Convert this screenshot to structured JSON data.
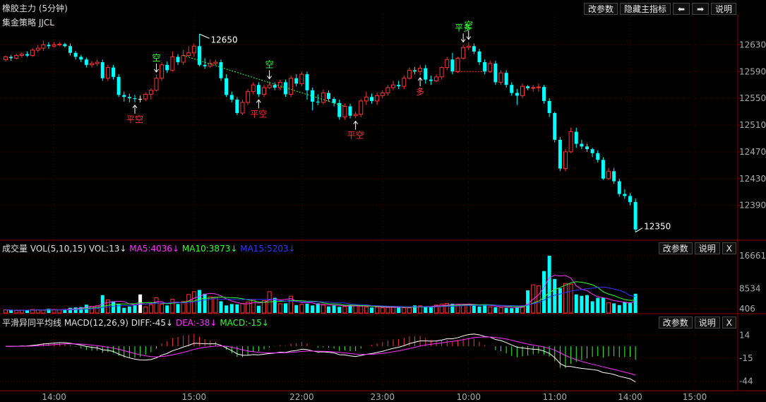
{
  "header": {
    "title": "橡胶主力 (5分钟)",
    "strategy": "集金策略 JJCL",
    "buttons": {
      "params": "改参数",
      "hide_main": "隐藏主指标",
      "prev": "⬅",
      "next": "➡",
      "help": "说明"
    }
  },
  "volume_panel": {
    "label_parts": [
      {
        "text": "成交量 VOL(5,10,15) VOL:13↓",
        "color": "#e0e0e0"
      },
      {
        "text": "MA5:4036↓",
        "color": "#ff33ff"
      },
      {
        "text": "MA10:3873↓",
        "color": "#33ff33"
      },
      {
        "text": "MA15:5203↓",
        "color": "#3333ff"
      }
    ],
    "buttons": {
      "params": "改参数",
      "help": "说明",
      "close": "X"
    }
  },
  "macd_panel": {
    "label_parts": [
      {
        "text": "平滑异同平均线 MACD(12,26,9) DIFF:-45↓",
        "color": "#e0e0e0"
      },
      {
        "text": "DEA:-38↓",
        "color": "#ff33ff"
      },
      {
        "text": "MACD:-15↓",
        "color": "#33ff33"
      }
    ],
    "buttons": {
      "params": "改参数",
      "help": "说明",
      "close": "X"
    }
  },
  "colors": {
    "up": "#ff3333",
    "down": "#00ffff",
    "flat": "#ffffff",
    "grid": "#4a0000",
    "axis": "#aaaaaa"
  },
  "chart_data": [
    {
      "type": "candlestick",
      "yticks": [
        12630,
        12590,
        12550,
        12510,
        12470,
        12430,
        12390
      ],
      "ylim": [
        12340,
        12660
      ],
      "annotations": {
        "high_value": "12650",
        "low_value": "12350"
      },
      "candles": [
        [
          12608,
          12612,
          12614,
          12605
        ],
        [
          12612,
          12610,
          12615,
          12606
        ],
        [
          12610,
          12614,
          12617,
          12608
        ],
        [
          12614,
          12616,
          12619,
          12611
        ],
        [
          12616,
          12614,
          12620,
          12612
        ],
        [
          12614,
          12622,
          12625,
          12612
        ],
        [
          12622,
          12625,
          12630,
          12619
        ],
        [
          12625,
          12630,
          12636,
          12621
        ],
        [
          12630,
          12628,
          12634,
          12624
        ],
        [
          12628,
          12630,
          12634,
          12626
        ],
        [
          12630,
          12631,
          12634,
          12628
        ],
        [
          12631,
          12628,
          12633,
          12626
        ],
        [
          12628,
          12618,
          12632,
          12614
        ],
        [
          12618,
          12612,
          12621,
          12608
        ],
        [
          12612,
          12608,
          12615,
          12604
        ],
        [
          12608,
          12600,
          12611,
          12596
        ],
        [
          12600,
          12602,
          12606,
          12596
        ],
        [
          12602,
          12604,
          12608,
          12598
        ],
        [
          12604,
          12580,
          12608,
          12576
        ],
        [
          12580,
          12596,
          12600,
          12576
        ],
        [
          12596,
          12582,
          12600,
          12578
        ],
        [
          12582,
          12555,
          12586,
          12552
        ],
        [
          12555,
          12552,
          12560,
          12545
        ],
        [
          12552,
          12550,
          12557,
          12544
        ],
        [
          12550,
          12549,
          12555,
          12544
        ],
        [
          12549,
          12549,
          12554,
          12544
        ],
        [
          12549,
          12556,
          12559,
          12546
        ],
        [
          12556,
          12562,
          12565,
          12548
        ],
        [
          12562,
          12580,
          12585,
          12560
        ],
        [
          12580,
          12600,
          12604,
          12576
        ],
        [
          12600,
          12592,
          12605,
          12588
        ],
        [
          12592,
          12612,
          12620,
          12590
        ],
        [
          12612,
          12604,
          12616,
          12600
        ],
        [
          12604,
          12614,
          12622,
          12600
        ],
        [
          12614,
          12618,
          12628,
          12612
        ],
        [
          12618,
          12628,
          12632,
          12612
        ],
        [
          12628,
          12600,
          12646,
          12598
        ],
        [
          12600,
          12598,
          12610,
          12594
        ],
        [
          12598,
          12602,
          12608,
          12595
        ],
        [
          12602,
          12604,
          12608,
          12599
        ],
        [
          12604,
          12580,
          12608,
          12576
        ],
        [
          12580,
          12555,
          12586,
          12552
        ],
        [
          12555,
          12548,
          12560,
          12544
        ],
        [
          12548,
          12528,
          12552,
          12525
        ],
        [
          12528,
          12544,
          12548,
          12525
        ],
        [
          12544,
          12560,
          12564,
          12540
        ],
        [
          12560,
          12570,
          12574,
          12556
        ],
        [
          12570,
          12556,
          12574,
          12552
        ],
        [
          12556,
          12566,
          12570,
          12552
        ],
        [
          12566,
          12570,
          12575,
          12564
        ],
        [
          12570,
          12566,
          12574,
          12562
        ],
        [
          12566,
          12574,
          12578,
          12562
        ],
        [
          12574,
          12556,
          12578,
          12552
        ],
        [
          12556,
          12580,
          12584,
          12552
        ],
        [
          12580,
          12572,
          12586,
          12568
        ],
        [
          12572,
          12586,
          12590,
          12568
        ],
        [
          12586,
          12562,
          12590,
          12548
        ],
        [
          12562,
          12545,
          12566,
          12532
        ],
        [
          12545,
          12544,
          12556,
          12540
        ],
        [
          12544,
          12558,
          12563,
          12541
        ],
        [
          12558,
          12549,
          12562,
          12545
        ],
        [
          12549,
          12543,
          12552,
          12538
        ],
        [
          12543,
          12522,
          12548,
          12518
        ],
        [
          12522,
          12538,
          12542,
          12518
        ],
        [
          12538,
          12524,
          12542,
          12520
        ],
        [
          12524,
          12526,
          12530,
          12520
        ],
        [
          12526,
          12546,
          12549,
          12522
        ],
        [
          12546,
          12552,
          12560,
          12540
        ],
        [
          12552,
          12546,
          12557,
          12542
        ],
        [
          12546,
          12554,
          12559,
          12540
        ],
        [
          12554,
          12558,
          12562,
          12550
        ],
        [
          12558,
          12566,
          12570,
          12554
        ],
        [
          12566,
          12570,
          12576,
          12562
        ],
        [
          12570,
          12568,
          12576,
          12564
        ],
        [
          12568,
          12580,
          12584,
          12564
        ],
        [
          12580,
          12592,
          12596,
          12578
        ],
        [
          12592,
          12590,
          12597,
          12586
        ],
        [
          12590,
          12595,
          12600,
          12585
        ],
        [
          12595,
          12578,
          12600,
          12572
        ],
        [
          12578,
          12576,
          12584,
          12570
        ],
        [
          12576,
          12582,
          12586,
          12574
        ],
        [
          12582,
          12596,
          12598,
          12578
        ],
        [
          12596,
          12608,
          12612,
          12592
        ],
        [
          12608,
          12590,
          12618,
          12586
        ],
        [
          12590,
          12610,
          12612,
          12588
        ],
        [
          12610,
          12626,
          12630,
          12608
        ],
        [
          12626,
          12628,
          12634,
          12622
        ],
        [
          12628,
          12620,
          12632,
          12616
        ],
        [
          12620,
          12604,
          12624,
          12600
        ],
        [
          12604,
          12590,
          12608,
          12586
        ],
        [
          12590,
          12602,
          12606,
          12588
        ],
        [
          12602,
          12574,
          12606,
          12570
        ],
        [
          12574,
          12588,
          12592,
          12570
        ],
        [
          12588,
          12570,
          12592,
          12566
        ],
        [
          12570,
          12558,
          12574,
          12554
        ],
        [
          12558,
          12554,
          12564,
          12540
        ],
        [
          12554,
          12568,
          12572,
          12550
        ],
        [
          12568,
          12565,
          12570,
          12562
        ],
        [
          12565,
          12566,
          12570,
          12560
        ],
        [
          12566,
          12567,
          12572,
          12560
        ],
        [
          12567,
          12546,
          12570,
          12542
        ],
        [
          12546,
          12528,
          12550,
          12522
        ],
        [
          12528,
          12488,
          12530,
          12484
        ],
        [
          12488,
          12445,
          12492,
          12441
        ],
        [
          12445,
          12470,
          12474,
          12441
        ],
        [
          12470,
          12500,
          12506,
          12468
        ],
        [
          12500,
          12482,
          12506,
          12476
        ],
        [
          12482,
          12478,
          12488,
          12474
        ],
        [
          12478,
          12474,
          12482,
          12470
        ],
        [
          12474,
          12468,
          12476,
          12462
        ],
        [
          12468,
          12458,
          12472,
          12454
        ],
        [
          12458,
          12430,
          12462,
          12428
        ],
        [
          12430,
          12441,
          12446,
          12428
        ],
        [
          12441,
          12426,
          12446,
          12422
        ],
        [
          12426,
          12407,
          12430,
          12403
        ],
        [
          12407,
          12404,
          12414,
          12400
        ],
        [
          12404,
          12395,
          12408,
          12390
        ],
        [
          12395,
          12354,
          12400,
          12350
        ]
      ],
      "trendlines": [
        {
          "from": 33,
          "to": 63,
          "color": "#33ff33"
        },
        {
          "from": 83,
          "to": 89,
          "color": "#ff3333"
        }
      ],
      "signals": [
        {
          "index": 24,
          "text": "平空",
          "color": "#ff3333",
          "pos": "below"
        },
        {
          "index": 28,
          "text": "空",
          "color": "#33ff33",
          "pos": "above"
        },
        {
          "index": 47,
          "text": "平空",
          "color": "#ff3333",
          "pos": "below"
        },
        {
          "index": 49,
          "text": "空",
          "color": "#33ff33",
          "pos": "above"
        },
        {
          "index": 65,
          "text": "平空",
          "color": "#ff3333",
          "pos": "below"
        },
        {
          "index": 77,
          "text": "多",
          "color": "#ff3333",
          "pos": "below"
        },
        {
          "index": 85,
          "text": "平多",
          "color": "#33ff33",
          "pos": "above"
        },
        {
          "index": 86,
          "text": "空",
          "color": "#33ff33",
          "pos": "above"
        }
      ]
    },
    {
      "type": "bar",
      "yticks": [
        "16661",
        "8534",
        "406"
      ],
      "ylim": [
        0,
        16661
      ],
      "volume": [
        900,
        800,
        700,
        800,
        900,
        1000,
        900,
        800,
        1200,
        1000,
        900,
        1100,
        1500,
        1600,
        1700,
        2400,
        1900,
        2100,
        5200,
        3800,
        3400,
        2600,
        1500,
        1900,
        2400,
        5400,
        1800,
        2400,
        4400,
        2600,
        2200,
        4000,
        2600,
        3300,
        5400,
        6200,
        6700,
        5600,
        4700,
        4600,
        3400,
        2200,
        2600,
        2500,
        2800,
        3200,
        3900,
        2100,
        3600,
        6200,
        4400,
        2700,
        2800,
        4900,
        2300,
        2500,
        2700,
        2200,
        2800,
        2300,
        1900,
        2200,
        1800,
        1900,
        2400,
        2100,
        2000,
        1800,
        1600,
        1700,
        1500,
        1600,
        1700,
        1800,
        1500,
        1500,
        2200,
        2100,
        1900,
        1800,
        2300,
        2600,
        2800,
        2700,
        2500,
        2200,
        2600,
        2500,
        1900,
        2300,
        1800,
        1700,
        1600,
        1500,
        1400,
        1700,
        2100,
        6600,
        8200,
        7900,
        12200,
        16661,
        9900,
        7200,
        8600,
        8400,
        5400,
        5000,
        5200,
        3400,
        4400,
        4400,
        3000,
        2800,
        2300,
        3200,
        3100,
        5600
      ],
      "ma": [
        {
          "name": "MA5",
          "color": "#ff33ff"
        },
        {
          "name": "MA10",
          "color": "#33ff33"
        },
        {
          "name": "MA15",
          "color": "#3333ff"
        }
      ]
    },
    {
      "type": "line",
      "yticks": [
        "14",
        "-15",
        "-44"
      ],
      "ylim": [
        -55,
        25
      ],
      "series": [
        {
          "name": "DIFF",
          "color": "#ffffff"
        },
        {
          "name": "DEA",
          "color": "#ff33ff"
        },
        {
          "name": "MACD",
          "color": "#33ff33"
        }
      ]
    }
  ],
  "x_axis": {
    "ticks": [
      {
        "index": 9,
        "label": "14:00"
      },
      {
        "index": 35,
        "label": "15:00"
      },
      {
        "index": 55,
        "label": "22:00"
      },
      {
        "index": 70,
        "label": "23:00"
      },
      {
        "index": 86,
        "label": "10:00"
      },
      {
        "index": 102,
        "label": "11:00"
      },
      {
        "index": 116,
        "label": "14:00"
      },
      {
        "index": 128,
        "label": "15:00"
      }
    ]
  }
}
